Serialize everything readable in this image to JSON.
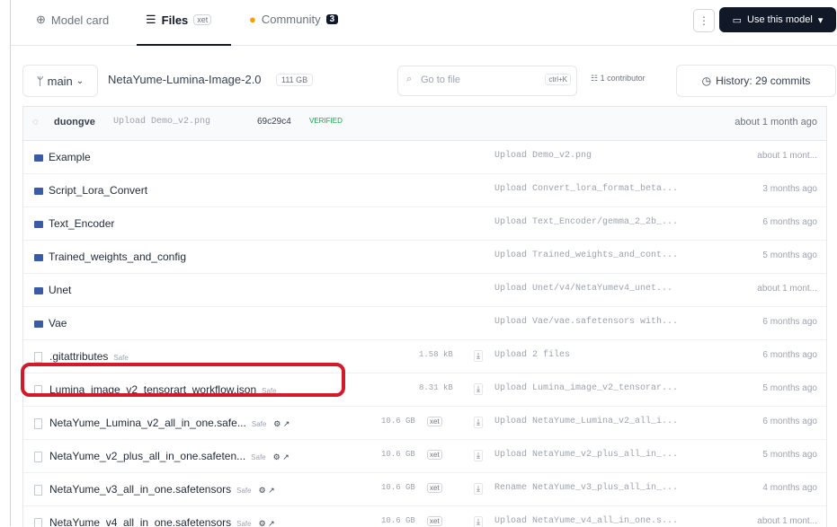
{
  "tabs": [
    {
      "label": "Model card",
      "active": false
    },
    {
      "label": "Files",
      "active": true,
      "pill": "xet"
    },
    {
      "label": "Community",
      "active": false,
      "count": "3"
    }
  ],
  "header_actions": {
    "more_icon": "⋮",
    "use_model_label": "Use this model"
  },
  "branch": {
    "name": "main"
  },
  "repo": {
    "path": "NetaYume-Lumina-Image-2.0",
    "size": "111 GB"
  },
  "goto": {
    "placeholder": "Go to file",
    "shortcut": "ctrl+K"
  },
  "contributors": "1 contributor",
  "history": "History: 29 commits",
  "last_commit": {
    "author": "duongve",
    "message": "Upload Demo_v2.png",
    "hash": "69c29c4",
    "verified": "VERIFIED",
    "date": "about 1 month ago"
  },
  "rows": [
    {
      "type": "folder",
      "name": "Example",
      "commit": "Upload Demo_v2.png",
      "date": "about 1 mont..."
    },
    {
      "type": "folder",
      "name": "Script_Lora_Convert",
      "commit": "Upload Convert_lora_format_beta...",
      "date": "3 months ago"
    },
    {
      "type": "folder",
      "name": "Text_Encoder",
      "commit": "Upload Text_Encoder/gemma_2_2b_...",
      "date": "6 months ago"
    },
    {
      "type": "folder",
      "name": "Trained_weights_and_config",
      "commit": "Upload Trained_weights_and_cont...",
      "date": "5 months ago"
    },
    {
      "type": "folder",
      "name": "Unet",
      "commit": "Upload Unet/v4/NetaYumev4_unet...",
      "date": "about 1 mont..."
    },
    {
      "type": "folder",
      "name": "Vae",
      "commit": "Upload Vae/vae.safetensors with...",
      "date": "6 months ago"
    },
    {
      "type": "file",
      "name": ".gitattributes",
      "safe": "Safe",
      "size": "1.58 kB",
      "commit": "Upload 2 files",
      "date": "6 months ago"
    },
    {
      "type": "file",
      "name": "Lumina_image_v2_tensorart_workflow.json",
      "safe": "Safe",
      "size": "8.31 kB",
      "commit": "Upload Lumina_image_v2_tensorar...",
      "date": "5 months ago",
      "highlighted": true
    },
    {
      "type": "file",
      "name": "NetaYume_Lumina_v2_all_in_one.safe...",
      "safe": "Safe",
      "pickle": "⚙ ↗",
      "size": "10.6 GB",
      "xet": "xet",
      "commit": "Upload NetaYume_Lumina_v2_all_i...",
      "date": "6 months ago"
    },
    {
      "type": "file",
      "name": "NetaYume_v2_plus_all_in_one.safeten...",
      "safe": "Safe",
      "pickle": "⚙ ↗",
      "size": "10.6 GB",
      "xet": "xet",
      "commit": "Upload NetaYume_v2_plus_all_in_...",
      "date": "5 months ago"
    },
    {
      "type": "file",
      "name": "NetaYume_v3_all_in_one.safetensors",
      "safe": "Safe",
      "pickle": "⚙ ↗",
      "size": "10.6 GB",
      "xet": "xet",
      "commit": "Rename NetaYume_v3_plus_all_in_...",
      "date": "4 months ago"
    },
    {
      "type": "file",
      "name": "NetaYume_v4_all_in_one.safetensors",
      "safe": "Safe",
      "pickle": "⚙ ↗",
      "size": "10.6 GB",
      "xet": "xet",
      "commit": "Upload NetaYume_v4_all_in_one.s...",
      "date": "about 1 mont..."
    }
  ],
  "colors": {
    "highlight": "#d11a2a",
    "folder": "#3b5ba5",
    "verified": "#16a34a"
  }
}
